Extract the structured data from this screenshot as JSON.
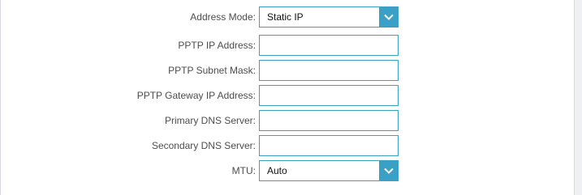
{
  "form": {
    "address_mode": {
      "label": "Address Mode:",
      "value": "Static IP"
    },
    "pptp_ip": {
      "label": "PPTP IP Address:",
      "value": ""
    },
    "pptp_subnet": {
      "label": "PPTP Subnet Mask:",
      "value": ""
    },
    "pptp_gateway": {
      "label": "PPTP Gateway IP Address:",
      "value": ""
    },
    "primary_dns": {
      "label": "Primary DNS Server:",
      "value": ""
    },
    "secondary_dns": {
      "label": "Secondary DNS Server:",
      "value": ""
    },
    "mtu": {
      "label": "MTU:",
      "value": "Auto"
    }
  },
  "icons": {
    "dropdown": "chevron-down-icon"
  },
  "colors": {
    "accent": "#3aa0c6",
    "label_text": "#4d4d4d",
    "page_bg": "#eef0f3"
  }
}
